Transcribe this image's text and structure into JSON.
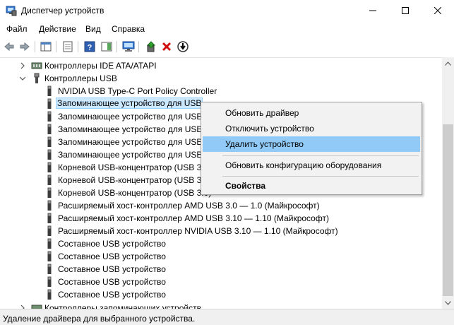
{
  "window": {
    "title": "Диспетчер устройств"
  },
  "menu": [
    "Файл",
    "Действие",
    "Вид",
    "Справка"
  ],
  "toolbar": {
    "buttons": [
      "back-icon",
      "forward-icon",
      "show-hide-console-tree-icon",
      "properties-icon",
      "help-icon",
      "action-pane-icon",
      "monitor-icon",
      "update-driver-icon",
      "uninstall-icon",
      "disable-device-icon"
    ]
  },
  "tree": {
    "ide_category": "Контроллеры IDE ATA/ATAPI",
    "usb_category": "Контроллеры USB",
    "usb_items": [
      "NVIDIA USB Type-C Port Policy Controller",
      "Запоминающее устройство для USB",
      "Запоминающее устройство для USB",
      "Запоминающее устройство для USB",
      "Запоминающее устройство для USB",
      "Запоминающее устройство для USB",
      "Корневой USB-концентратор (USB 3.0)",
      "Корневой USB-концентратор (USB 3.0)",
      "Корневой USB-концентратор (USB 3.0)",
      "Расширяемый хост-контроллер AMD USB 3.0 — 1.0 (Майкрософт)",
      "Расширяемый хост-контроллер AMD USB 3.10 — 1.10 (Майкрософт)",
      "Расширяемый хост-контроллер NVIDIA USB 3.10 — 1.10 (Майкрософт)",
      "Составное USB устройство",
      "Составное USB устройство",
      "Составное USB устройство",
      "Составное USB устройство",
      "Составное USB устройство"
    ],
    "storage_category": "Контроллеры запоминающих устройств"
  },
  "context_menu": {
    "update_driver": "Обновить драйвер",
    "disable_device": "Отключить устройство",
    "uninstall_device": "Удалить устройство",
    "scan_hardware": "Обновить конфигурацию оборудования",
    "properties": "Свойства"
  },
  "status": {
    "text": "Удаление драйвера для выбранного устройства."
  },
  "colors": {
    "selection_bg": "#cce8ff",
    "menu_highlight": "#91c9f7",
    "uninstall_red": "#d01010"
  }
}
